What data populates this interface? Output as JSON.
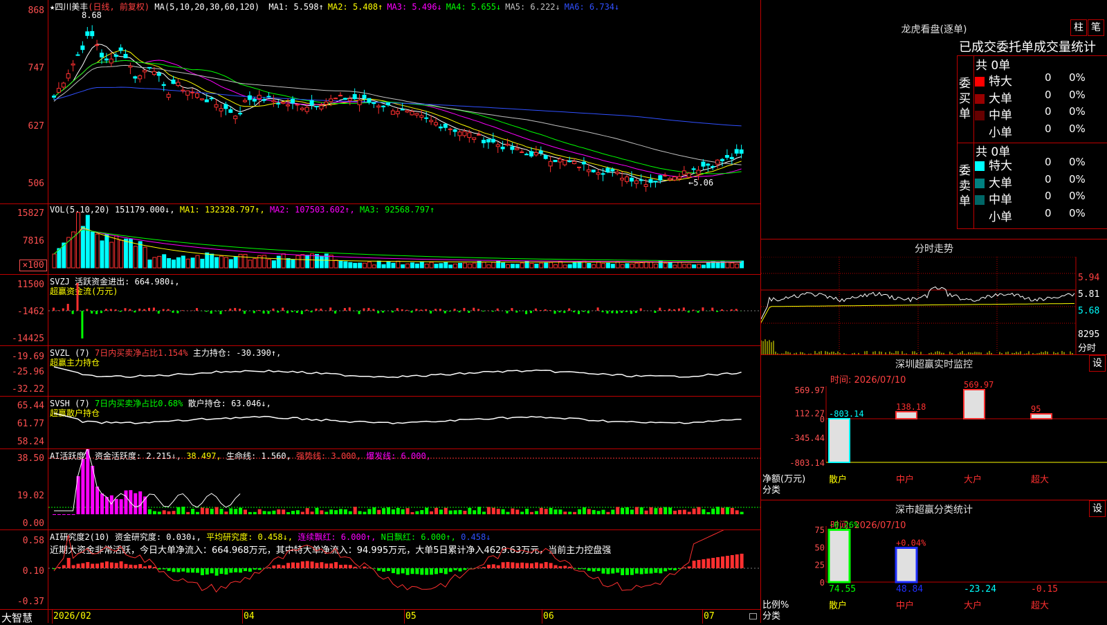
{
  "stock": {
    "star": "★",
    "name": "四川美丰",
    "period_label": "(日线, 前复权)"
  },
  "main": {
    "ma_header": "MA(5,10,20,30,60,120)",
    "ma": [
      {
        "label": "MA1:",
        "value": "5.598↑",
        "color": "#ffffff"
      },
      {
        "label": "MA2:",
        "value": "5.408↑",
        "color": "#ffff00"
      },
      {
        "label": "MA3:",
        "value": "5.496↓",
        "color": "#ff00ff"
      },
      {
        "label": "MA4:",
        "value": "5.655↓",
        "color": "#00ff00"
      },
      {
        "label": "MA5:",
        "value": "6.222↓",
        "color": "#c0c0c0"
      },
      {
        "label": "MA6:",
        "value": "6.734↓",
        "color": "#3050ff"
      }
    ],
    "y_ticks": [
      "868",
      "747",
      "627",
      "506"
    ],
    "high_marker": "8.68",
    "low_marker": "←5.06"
  },
  "vol": {
    "header": "VOL(5,10,20)",
    "value": "151179.000↓,",
    "ma1": "MA1: 132328.797↑,",
    "ma2": "MA2: 107503.602↑,",
    "ma3": "MA3: 92568.797↑",
    "y_ticks": [
      "15827",
      "7816",
      "×100"
    ]
  },
  "svzj": {
    "header": "SVZJ",
    "label": "活跃资金进出: 664.980↓,",
    "subtitle": "超赢资金流(万元)",
    "y_ticks": [
      "11500",
      "-1462",
      "-14425"
    ]
  },
  "svzl": {
    "header": "SVZL (7)",
    "desc": "7日内买卖净占比1.154%",
    "label": "主力持仓: -30.390↑,",
    "subtitle": "超赢主力持仓",
    "y_ticks": [
      "-19.69",
      "-25.96",
      "-32.22"
    ]
  },
  "svsh": {
    "header": "SVSH (7)",
    "desc": "7日内买卖净占比0.68%",
    "label": "散户持仓: 63.046↓,",
    "subtitle": "超赢散户持仓",
    "y_ticks": [
      "65.44",
      "61.77",
      "58.24"
    ]
  },
  "ai_active": {
    "header": "AI活跃度2",
    "v1": "资金活跃度: 2.215↓,",
    "v2": "38.497,",
    "v3": "生命线: 1.560,",
    "v4": "强势线: 3.000,",
    "v5": "爆发线: 6.000,",
    "y_ticks": [
      "38.50",
      "19.02",
      "0.00"
    ]
  },
  "ai_research": {
    "header": "AI研究度2(10)",
    "v1": "资金研究度: 0.030↓,",
    "v2": "平均研究度: 0.458↓,",
    "v3": "连续飘红: 6.000↑,",
    "v4": "N日飘红: 6.000↑,",
    "v5": "0.458↓",
    "comment": "近期大资金非常活跃，今日大单净流入：664.968万元，其中特大单净流入：94.995万元，大单5日累计净入4629.63万元，当前主力控盘强",
    "y_ticks": [
      "0.58",
      "0.10",
      "-0.37"
    ]
  },
  "x_axis": {
    "brand": "大智慧",
    "labels": [
      "2026/02",
      "04",
      "05",
      "06",
      "07"
    ]
  },
  "lhb": {
    "title": "龙虎看盘(逐单)",
    "btn1": "柱",
    "btn2": "笔",
    "subtitle": "已成交委托单成交量统计",
    "buy_label": "委买单",
    "sell_label": "委卖单",
    "buy_total": "共 0单",
    "sell_total": "共 0单",
    "buy_rows": [
      {
        "name": "特大",
        "count": "0",
        "pct": "0%",
        "color": "#ff0000"
      },
      {
        "name": "大单",
        "count": "0",
        "pct": "0%",
        "color": "#990000"
      },
      {
        "name": "中单",
        "count": "0",
        "pct": "0%",
        "color": "#660000"
      },
      {
        "name": "小单",
        "count": "0",
        "pct": "0%",
        "color": ""
      }
    ],
    "sell_rows": [
      {
        "name": "特大",
        "count": "0",
        "pct": "0%",
        "color": "#00ffff"
      },
      {
        "name": "大单",
        "count": "0",
        "pct": "0%",
        "color": "#008080"
      },
      {
        "name": "中单",
        "count": "0",
        "pct": "0%",
        "color": "#006666"
      },
      {
        "name": "小单",
        "count": "0",
        "pct": "0%",
        "color": ""
      }
    ]
  },
  "intraday": {
    "title": "分时走势",
    "y_ticks": [
      "5.94",
      "5.81",
      "5.68"
    ],
    "vol_label": "8295",
    "vol_unit": "分时"
  },
  "realtime": {
    "title": "深圳超赢实时监控",
    "btn": "设",
    "time": "时间: 2026/07/10",
    "y_ticks": [
      "569.97",
      "112.27",
      "0",
      "-345.44",
      "-803.14"
    ],
    "ylabel1": "净额(万元)",
    "ylabel2": "分类",
    "chart_data": {
      "type": "bar",
      "categories": [
        "散户",
        "中户",
        "大户",
        "超大"
      ],
      "values": [
        -803.14,
        138.18,
        569.97,
        95
      ],
      "value_labels": [
        "-803.14",
        "138.18",
        "569.97",
        "95"
      ],
      "ylim": [
        -803.14,
        569.97
      ]
    }
  },
  "classify": {
    "title": "深市超赢分类统计",
    "btn": "设",
    "time": "时间: 2026/07/10",
    "y_ticks": [
      "75",
      "50",
      "25",
      "0"
    ],
    "ylabel1": "比例%",
    "ylabel2": "分类",
    "chart_data": {
      "type": "bar",
      "categories": [
        "散户",
        "中户",
        "大户",
        "超大"
      ],
      "values": [
        74.55,
        48.84,
        0,
        0
      ],
      "bottom_labels": [
        "74.55",
        "48.84",
        "-23.24",
        "-0.15"
      ],
      "change_labels": [
        "-0.26%",
        "+0.04%",
        "",
        ""
      ],
      "ylim": [
        0,
        75
      ]
    }
  }
}
